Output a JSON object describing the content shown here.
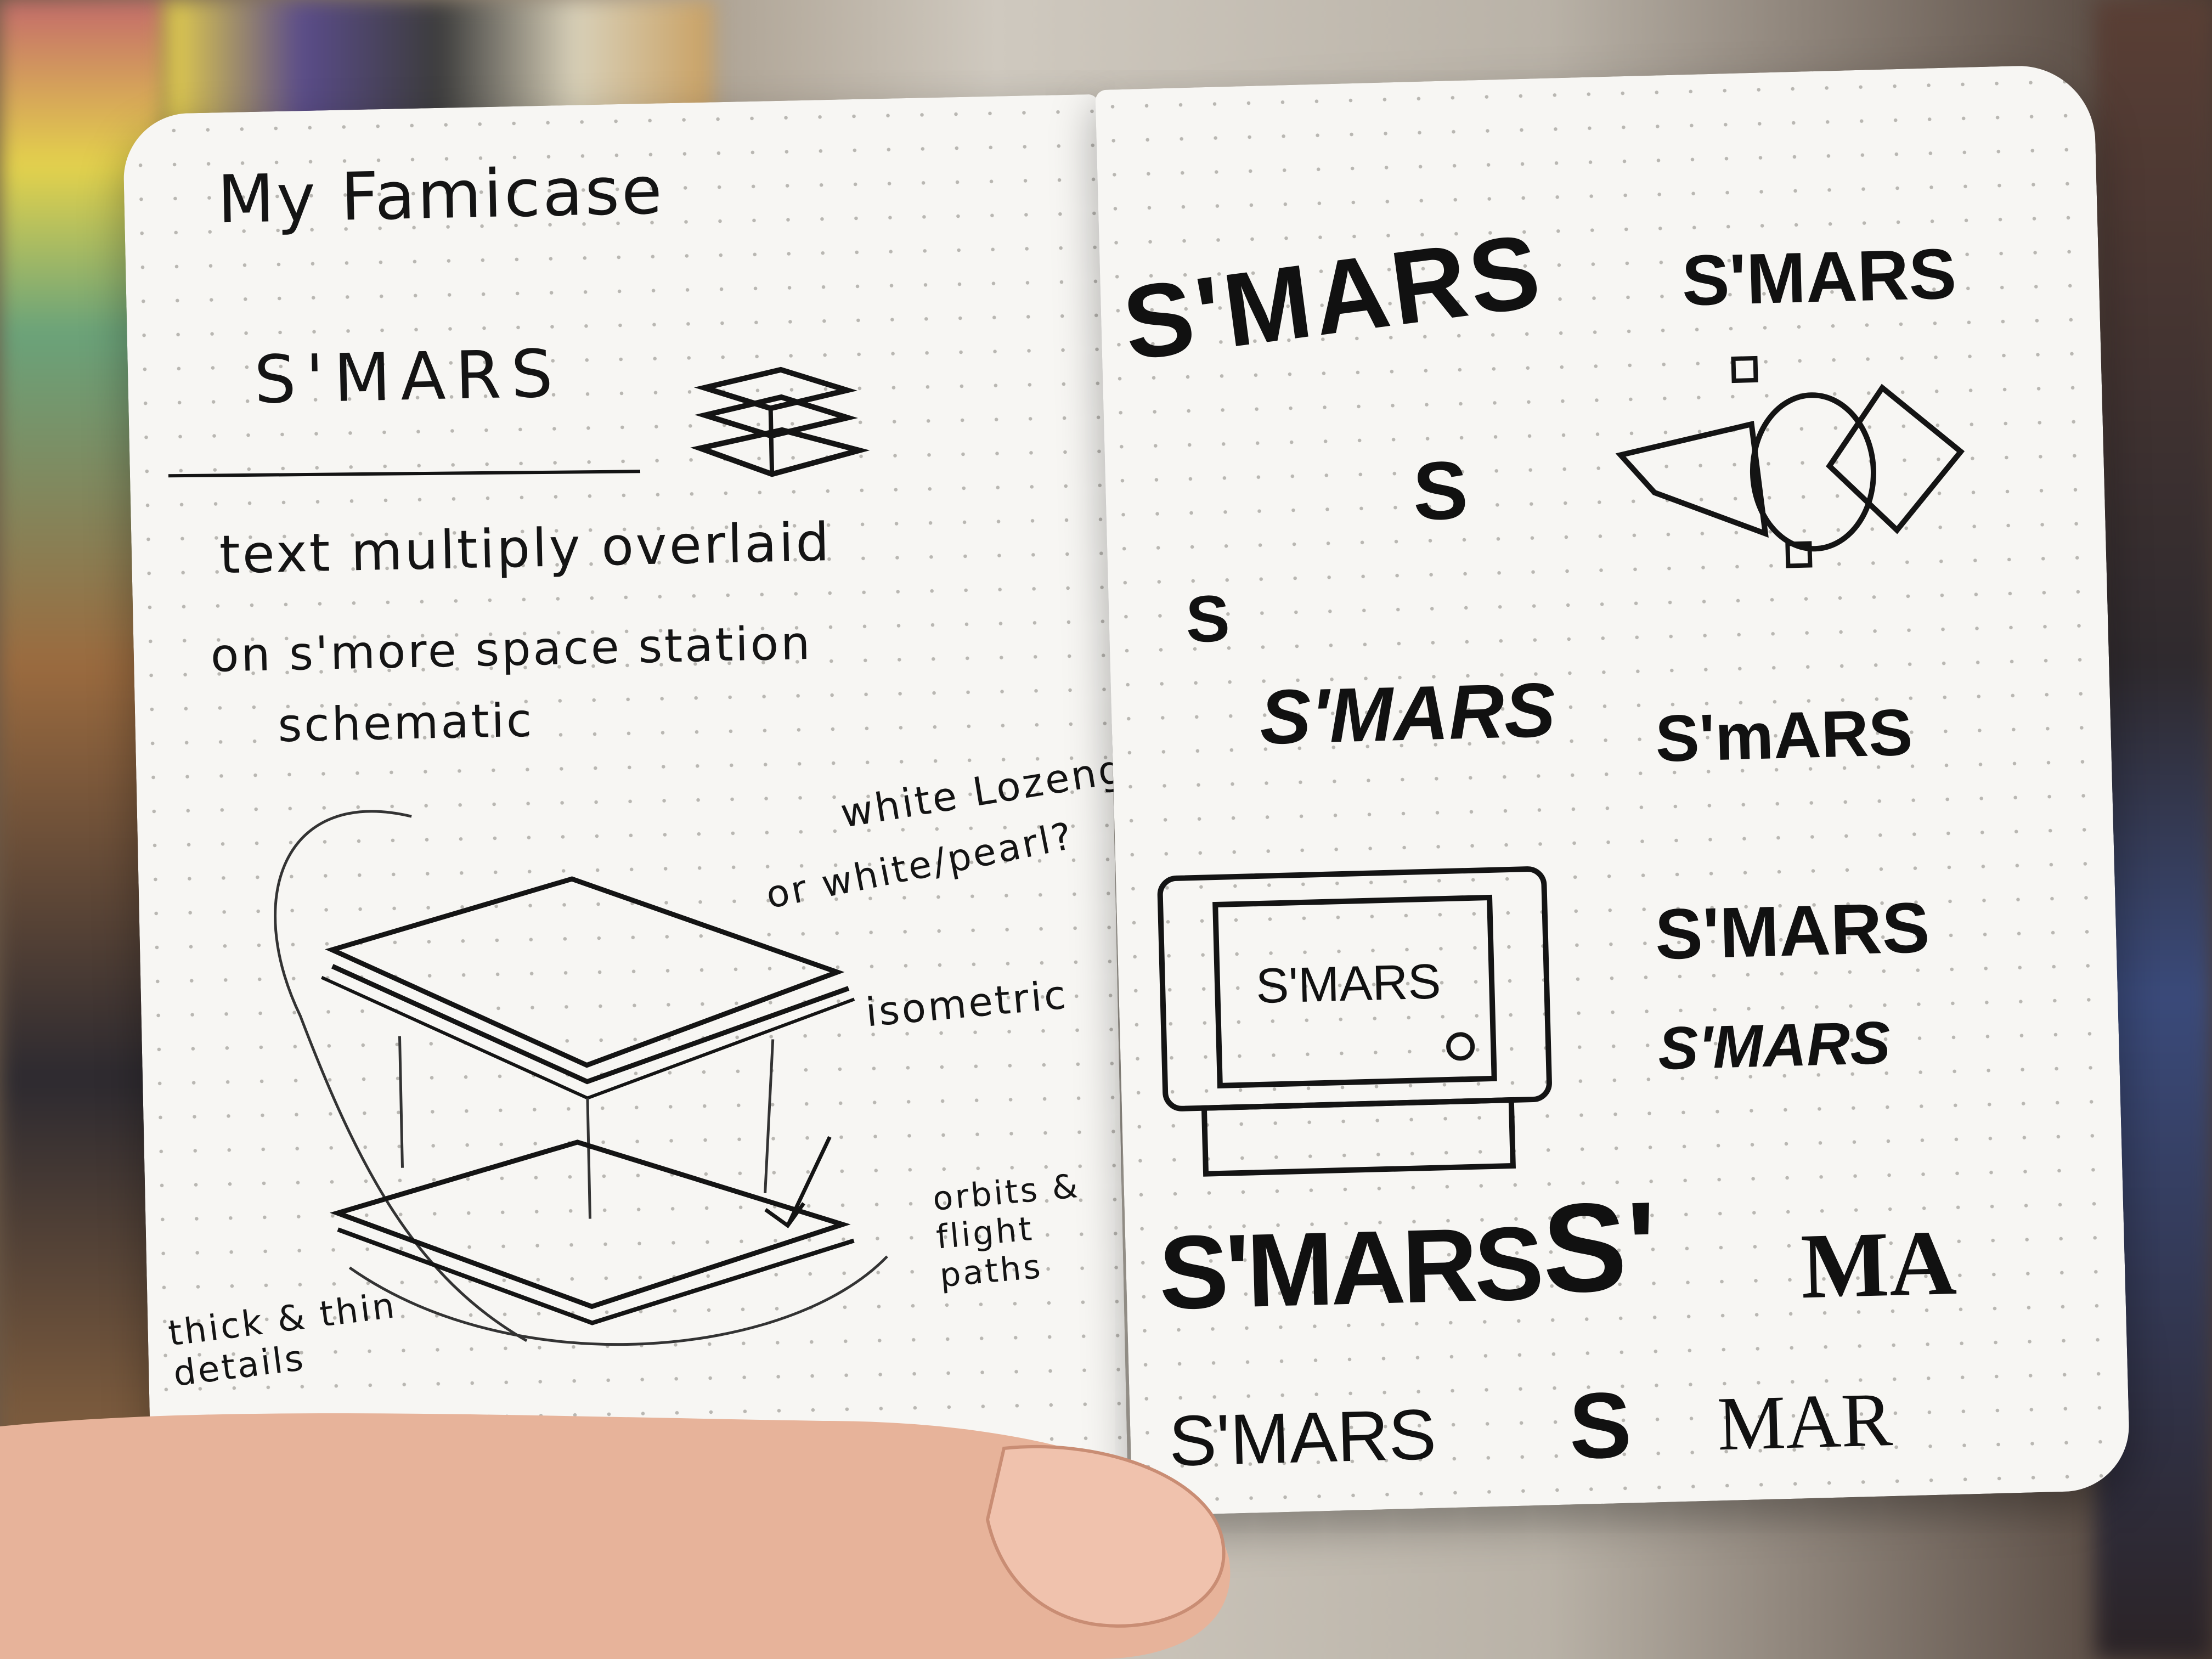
{
  "notebook": {
    "left_page": {
      "title": "My Famicase",
      "logo_text": "S'MARS",
      "note_line_1": "text multiply overlaid",
      "note_line_2": "on s'more space station",
      "note_line_3": "schematic",
      "annotation_white": "white Lozenge",
      "annotation_pearl": "or white/pearl?",
      "annotation_isometric": "isometric",
      "annotation_orbits": "orbits & flight paths",
      "annotation_details": "thick & thin details"
    },
    "right_page": {
      "logo_variants": [
        "S'MARS",
        "S'MARS",
        "S",
        "S",
        "S'MARS",
        "S'mARS",
        "S'MARS",
        "S'MARS",
        "S'MARS",
        "S'",
        "MA",
        "S'MARS",
        "S",
        "MAR"
      ],
      "cartridge_label": "S'MARS"
    }
  },
  "colors": {
    "paper": "#f7f6f3",
    "ink": "#141414",
    "skin": "#e7b39a"
  }
}
